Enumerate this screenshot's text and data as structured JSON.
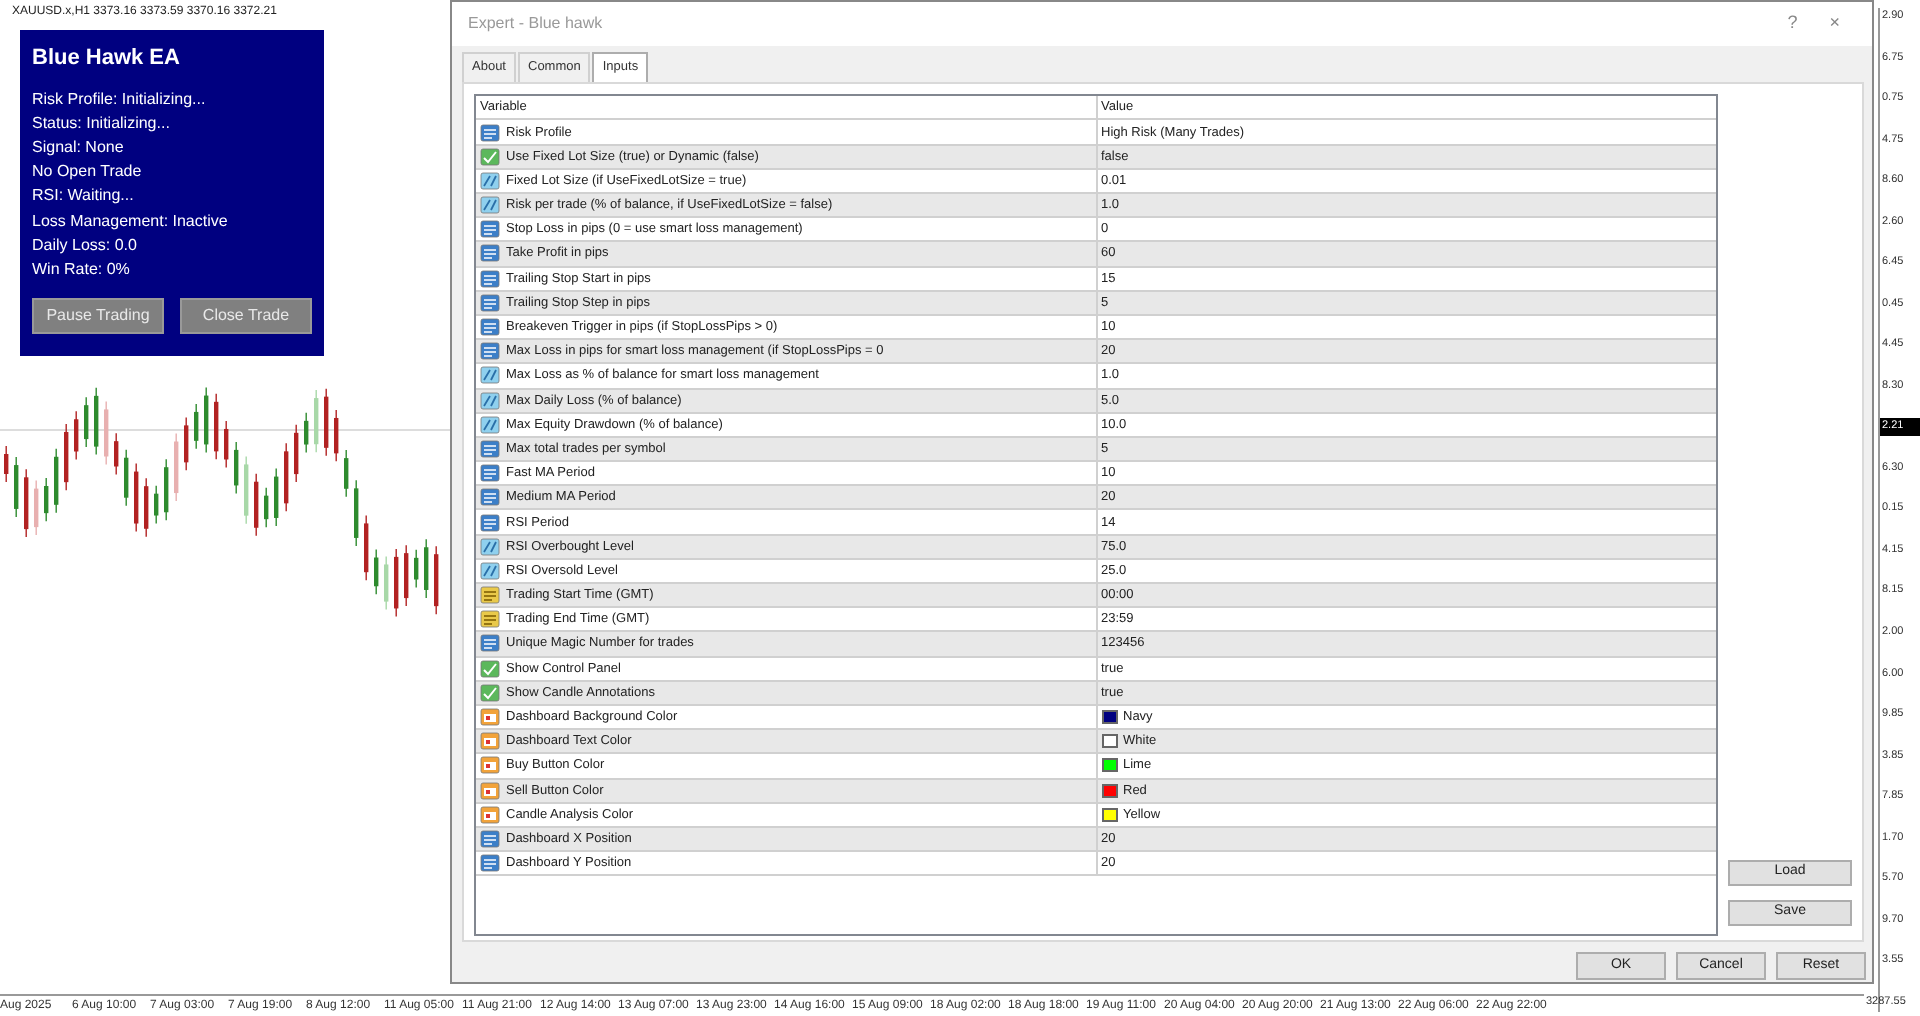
{
  "chart": {
    "symbol_line": "XAUUSD.x,H1  3373.16 3373.59 3370.16 3372.21",
    "price_labels": [
      {
        "text": "2.90",
        "current": false
      },
      {
        "text": "6.75",
        "current": false
      },
      {
        "text": "0.75",
        "current": false
      },
      {
        "text": "4.75",
        "current": false
      },
      {
        "text": "8.60",
        "current": false
      },
      {
        "text": "2.60",
        "current": false
      },
      {
        "text": "6.45",
        "current": false
      },
      {
        "text": "0.45",
        "current": false
      },
      {
        "text": "4.45",
        "current": false
      },
      {
        "text": "8.30",
        "current": false
      },
      {
        "text": "2.21",
        "current": true
      },
      {
        "text": "6.30",
        "current": false
      },
      {
        "text": "0.15",
        "current": false
      },
      {
        "text": "4.15",
        "current": false
      },
      {
        "text": "8.15",
        "current": false
      },
      {
        "text": "2.00",
        "current": false
      },
      {
        "text": "6.00",
        "current": false
      },
      {
        "text": "9.85",
        "current": false
      },
      {
        "text": "3.85",
        "current": false
      },
      {
        "text": "7.85",
        "current": false
      },
      {
        "text": "1.70",
        "current": false
      },
      {
        "text": "5.70",
        "current": false
      },
      {
        "text": "9.70",
        "current": false
      },
      {
        "text": "3.55",
        "current": false
      },
      {
        "text": "3287.55",
        "current": false
      }
    ],
    "time_labels": [
      "Aug 2025",
      "6 Aug 10:00",
      "7 Aug 03:00",
      "7 Aug 19:00",
      "8 Aug 12:00",
      "11 Aug 05:00",
      "11 Aug 21:00",
      "12 Aug 14:00",
      "13 Aug 07:00",
      "13 Aug 23:00",
      "14 Aug 16:00",
      "15 Aug 09:00",
      "18 Aug 02:00",
      "18 Aug 18:00",
      "19 Aug 11:00",
      "20 Aug 04:00",
      "20 Aug 20:00",
      "21 Aug 13:00",
      "22 Aug 06:00",
      "22 Aug 22:00"
    ]
  },
  "dashboard": {
    "title": "Blue Hawk EA",
    "lines": [
      "Risk Profile: Initializing...",
      "Status: Initializing...",
      "Signal: None",
      "No Open Trade",
      "RSI: Waiting...",
      "Loss Management: Inactive",
      "Daily Loss: 0.0",
      "Win Rate: 0%"
    ],
    "buttons": [
      "Pause Trading",
      "Close Trade"
    ]
  },
  "dialog": {
    "title": "Expert - Blue hawk",
    "help": "?",
    "close": "×",
    "tabs": [
      {
        "label": "About",
        "selected": false
      },
      {
        "label": "Common",
        "selected": false
      },
      {
        "label": "Inputs",
        "selected": true
      }
    ],
    "table": {
      "columns": [
        "Variable",
        "Value"
      ],
      "rows": [
        {
          "kind": "int",
          "variable": "Risk Profile",
          "value": "High Risk (Many Trades)"
        },
        {
          "kind": "bool",
          "variable": "Use Fixed Lot Size (true) or Dynamic (false)",
          "value": "false"
        },
        {
          "kind": "double",
          "variable": "Fixed Lot Size (if UseFixedLotSize = true)",
          "value": "0.01"
        },
        {
          "kind": "double",
          "variable": "Risk per trade (% of balance, if UseFixedLotSize = false)",
          "value": "1.0"
        },
        {
          "kind": "int",
          "variable": "Stop Loss in pips (0 = use smart loss management)",
          "value": "0"
        },
        {
          "kind": "int",
          "variable": "Take Profit in pips",
          "value": "60"
        },
        {
          "kind": "int",
          "variable": "Trailing Stop Start in pips",
          "value": "15"
        },
        {
          "kind": "int",
          "variable": "Trailing Stop Step in pips",
          "value": "5"
        },
        {
          "kind": "int",
          "variable": "Breakeven Trigger in pips (if StopLossPips > 0)",
          "value": "10"
        },
        {
          "kind": "int",
          "variable": "Max Loss in pips for smart loss management (if StopLossPips = 0",
          "value": "20"
        },
        {
          "kind": "double",
          "variable": "Max Loss as % of balance for smart loss management",
          "value": "1.0"
        },
        {
          "kind": "double",
          "variable": "Max Daily Loss (% of balance)",
          "value": "5.0"
        },
        {
          "kind": "double",
          "variable": "Max Equity Drawdown (% of balance)",
          "value": "10.0"
        },
        {
          "kind": "int",
          "variable": "Max total trades per symbol",
          "value": "5"
        },
        {
          "kind": "int",
          "variable": "Fast MA Period",
          "value": "10"
        },
        {
          "kind": "int",
          "variable": "Medium MA Period",
          "value": "20"
        },
        {
          "kind": "int",
          "variable": "RSI Period",
          "value": "14"
        },
        {
          "kind": "double",
          "variable": "RSI Overbought Level",
          "value": "75.0"
        },
        {
          "kind": "double",
          "variable": "RSI Oversold Level",
          "value": "25.0"
        },
        {
          "kind": "string",
          "variable": "Trading Start Time (GMT)",
          "value": "00:00"
        },
        {
          "kind": "string",
          "variable": "Trading End Time (GMT)",
          "value": "23:59"
        },
        {
          "kind": "int",
          "variable": "Unique Magic Number for trades",
          "value": "123456"
        },
        {
          "kind": "bool",
          "variable": "Show Control Panel",
          "value": "true"
        },
        {
          "kind": "bool",
          "variable": "Show Candle Annotations",
          "value": "true"
        },
        {
          "kind": "color",
          "variable": "Dashboard Background Color",
          "value": "Navy",
          "color": "#000080"
        },
        {
          "kind": "color",
          "variable": "Dashboard Text Color",
          "value": "White",
          "color": "#ffffff"
        },
        {
          "kind": "color",
          "variable": "Buy Button Color",
          "value": "Lime",
          "color": "#00ff00"
        },
        {
          "kind": "color",
          "variable": "Sell Button Color",
          "value": "Red",
          "color": "#ff0000"
        },
        {
          "kind": "color",
          "variable": "Candle Analysis Color",
          "value": "Yellow",
          "color": "#ffff00"
        },
        {
          "kind": "int",
          "variable": "Dashboard X Position",
          "value": "20"
        },
        {
          "kind": "int",
          "variable": "Dashboard Y Position",
          "value": "20"
        }
      ]
    },
    "side_buttons": [
      "Load",
      "Save"
    ],
    "footer_buttons": [
      "OK",
      "Cancel",
      "Reset"
    ]
  }
}
